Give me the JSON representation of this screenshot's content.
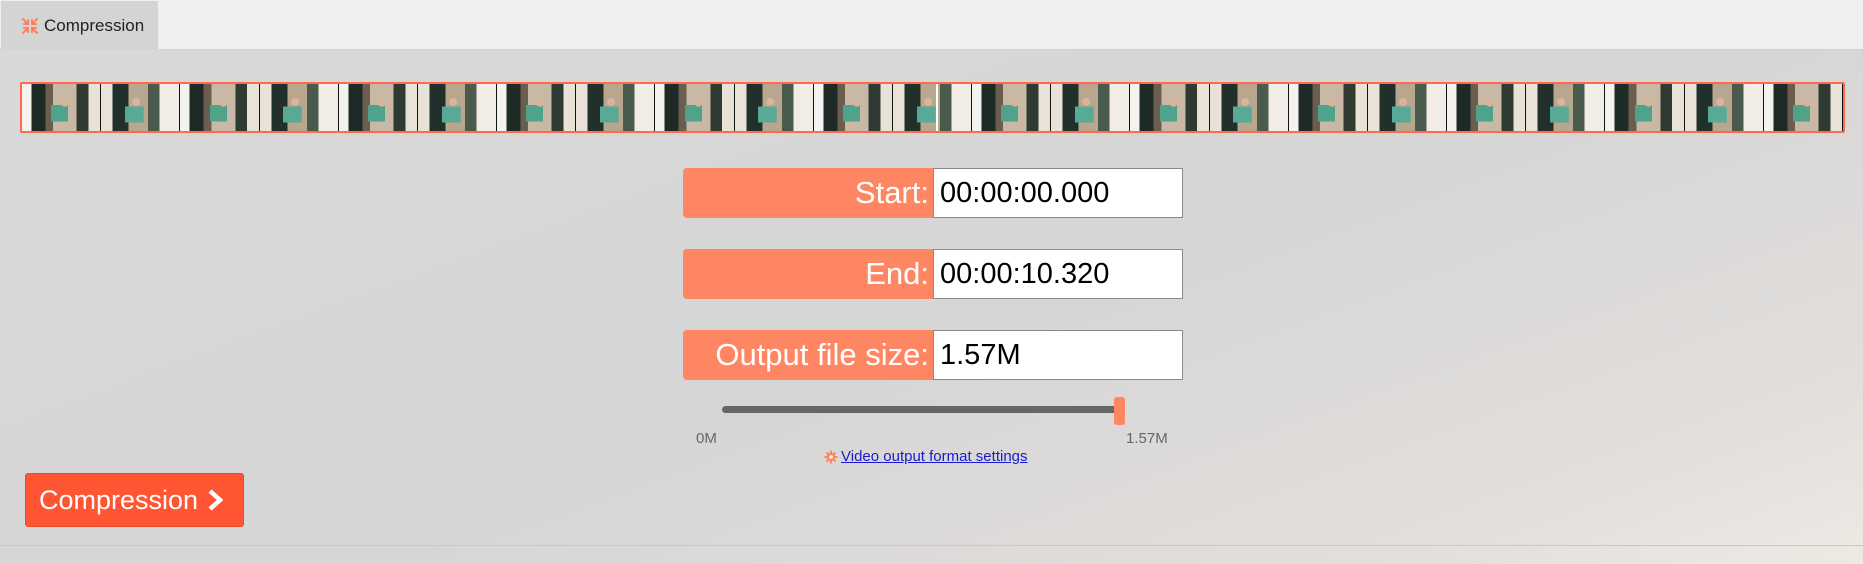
{
  "tab": {
    "label": "Compression",
    "icon": "compress-arrows-icon"
  },
  "filmstrip": {
    "frame_count": 23
  },
  "fields": {
    "start": {
      "label": "Start:",
      "value": "00:00:00.000"
    },
    "end": {
      "label": "End:",
      "value": "00:00:10.320"
    },
    "size": {
      "label": "Output file size:",
      "value": "1.57M"
    }
  },
  "slider": {
    "min_label": "0M",
    "max_label": "1.57M",
    "value_fraction": 1.0
  },
  "settings_link": {
    "label": "Video output format settings",
    "icon": "gear-icon"
  },
  "compress_button": {
    "label": "Compression",
    "icon": "chevron-right-icon"
  },
  "colors": {
    "accent": "#ff8663",
    "button": "#ff5533",
    "link": "#1a1ad0"
  }
}
